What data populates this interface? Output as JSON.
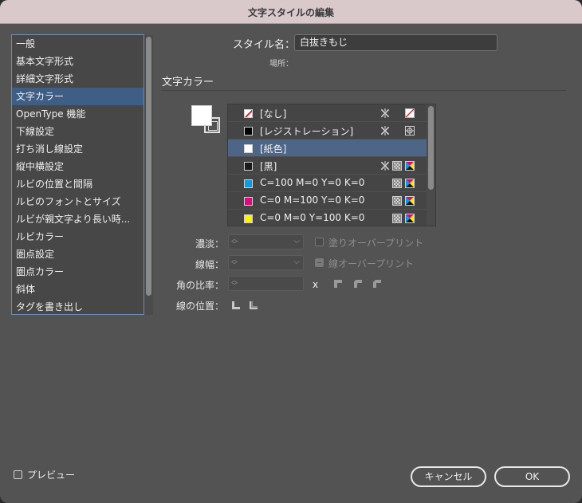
{
  "window": {
    "title": "文字スタイルの編集"
  },
  "sidebar": {
    "items": [
      {
        "label": "一般"
      },
      {
        "label": "基本文字形式"
      },
      {
        "label": "詳細文字形式"
      },
      {
        "label": "文字カラー",
        "selected": true
      },
      {
        "label": "OpenType 機能"
      },
      {
        "label": "下線設定"
      },
      {
        "label": "打ち消し線設定"
      },
      {
        "label": "縦中横設定"
      },
      {
        "label": "ルビの位置と間隔"
      },
      {
        "label": "ルビのフォントとサイズ"
      },
      {
        "label": "ルビが親文字より長い時..."
      },
      {
        "label": "ルビカラー"
      },
      {
        "label": "圏点設定"
      },
      {
        "label": "圏点カラー"
      },
      {
        "label": "斜体"
      },
      {
        "label": "タグを書き出し"
      }
    ]
  },
  "style_name": {
    "label": "スタイル名：",
    "value": "白抜きもじ"
  },
  "location": {
    "label": "場所："
  },
  "section": {
    "title": "文字カラー"
  },
  "swatches": [
    {
      "name": "[なし]",
      "color": "none",
      "noedit": true,
      "type_icon": "none-icon"
    },
    {
      "name": "[レジストレーション]",
      "color": "#000000",
      "noedit": true,
      "type_icon": "registration-icon"
    },
    {
      "name": "[紙色]",
      "color": "#ffffff",
      "selected": true
    },
    {
      "name": "[黒]",
      "color": "#1a1a1a",
      "noedit": true,
      "type_icon": "process-icon",
      "mode_icon": "cmyk-icon"
    },
    {
      "name": "C=100 M=0 Y=0 K=0",
      "color": "#0a9ee0",
      "type_icon": "process-icon",
      "mode_icon": "cmyk-icon"
    },
    {
      "name": "C=0 M=100 Y=0 K=0",
      "color": "#e0087e",
      "type_icon": "process-icon",
      "mode_icon": "cmyk-icon"
    },
    {
      "name": "C=0 M=0 Y=100 K=0",
      "color": "#fff100",
      "type_icon": "process-icon",
      "mode_icon": "cmyk-icon"
    }
  ],
  "controls": {
    "tint_label": "濃淡：",
    "tint_value": "",
    "overprint_fill_label": "塗りオーバープリント",
    "stroke_weight_label": "線幅：",
    "stroke_weight_value": "",
    "overprint_stroke_label": "線オーバープリント",
    "miter_label": "角の比率：",
    "miter_value": "",
    "miter_x": "x",
    "stroke_align_label": "線の位置："
  },
  "footer": {
    "preview_label": "プレビュー",
    "cancel_label": "キャンセル",
    "ok_label": "OK"
  },
  "colors": {
    "selection": "#3f5e86",
    "dialog_bg": "#535353",
    "titlebar": "#d9c9cb"
  }
}
